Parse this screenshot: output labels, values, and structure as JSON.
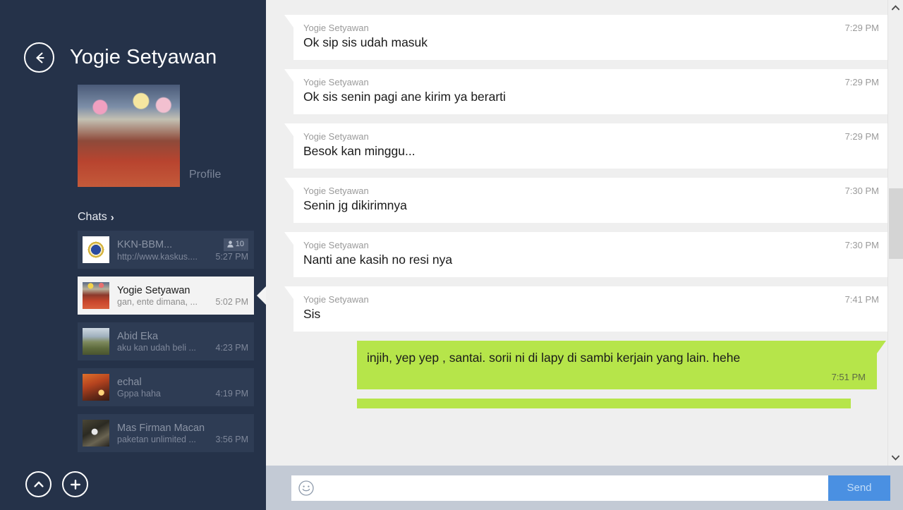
{
  "sidebar": {
    "back_button": "back-arrow",
    "title": "Yogie Setyawan",
    "profile_label": "Profile",
    "chats_heading": "Chats",
    "chats_chevron": "›",
    "items": [
      {
        "name": "KKN-BBM...",
        "snippet": "http://www.kaskus....",
        "time": "5:27 PM",
        "badge_count": "10",
        "selected": false,
        "avatar": "ph-kkn"
      },
      {
        "name": "Yogie Setyawan",
        "snippet": "gan, ente dimana, ...",
        "time": "5:02 PM",
        "badge_count": "",
        "selected": true,
        "avatar": "ph-yogie"
      },
      {
        "name": "Abid Eka",
        "snippet": "aku kan udah beli ...",
        "time": "4:23 PM",
        "badge_count": "",
        "selected": false,
        "avatar": "ph-abid"
      },
      {
        "name": "echal",
        "snippet": "Gppa haha",
        "time": "4:19 PM",
        "badge_count": "",
        "selected": false,
        "avatar": "ph-echal"
      },
      {
        "name": "Mas Firman Macan",
        "snippet": "paketan unlimited ...",
        "time": "3:56 PM",
        "badge_count": "",
        "selected": false,
        "avatar": "ph-firman"
      }
    ],
    "bottom_buttons": [
      {
        "icon": "chevron-up-icon"
      },
      {
        "icon": "plus-icon"
      }
    ]
  },
  "chat": {
    "messages": [
      {
        "direction": "in",
        "sender": "Yogie Setyawan",
        "text": "Ok sip sis udah masuk",
        "time": "7:29 PM"
      },
      {
        "direction": "in",
        "sender": "Yogie Setyawan",
        "text": "Ok sis senin pagi ane kirim ya berarti",
        "time": "7:29 PM"
      },
      {
        "direction": "in",
        "sender": "Yogie Setyawan",
        "text": "Besok kan minggu...",
        "time": "7:29 PM"
      },
      {
        "direction": "in",
        "sender": "Yogie Setyawan",
        "text": "Senin jg dikirimnya",
        "time": "7:30 PM"
      },
      {
        "direction": "in",
        "sender": "Yogie Setyawan",
        "text": "Nanti ane kasih no resi nya",
        "time": "7:30 PM"
      },
      {
        "direction": "in",
        "sender": "Yogie Setyawan",
        "text": "Sis",
        "time": "7:41 PM"
      },
      {
        "direction": "out",
        "sender": "",
        "text": "injih, yep yep , santai. sorii ni di lapy di sambi kerjain yang lain. hehe",
        "time": "7:51 PM"
      }
    ]
  },
  "composer": {
    "emoji_icon": "smiley-icon",
    "input_value": "",
    "input_placeholder": "",
    "send_label": "Send"
  },
  "scrollbar": {
    "up_arrow": "▲",
    "down_arrow": "▼"
  },
  "colors": {
    "sidebar_bg": "#253249",
    "chat_bg": "#efefef",
    "bubble_in": "#ffffff",
    "bubble_out": "#b6e54a",
    "send_button": "#4a90e2",
    "composer_bg": "#c3cad5",
    "selected_item": "#f3f3f3"
  }
}
